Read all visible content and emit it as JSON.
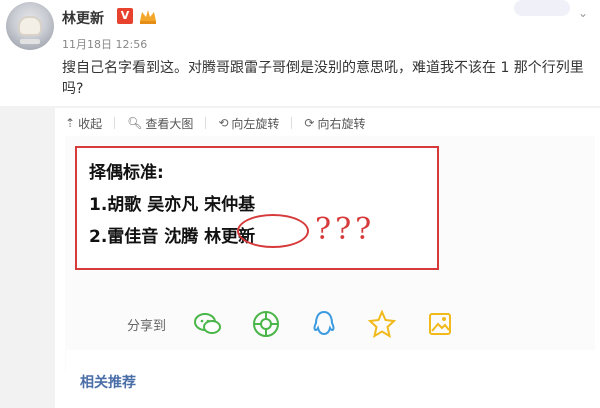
{
  "user": {
    "name": "林更新",
    "badge": "V",
    "time": "11月18日 12:56"
  },
  "post": {
    "text": "搜自己名字看到这。对腾哥跟雷子哥倒是没别的意思吼，难道我不该在 1 那个行列里吗?"
  },
  "toolbar": {
    "collapse": "收起",
    "view_large": "查看大图",
    "rotate_left": "向左旋转",
    "rotate_right": "向右旋转"
  },
  "image": {
    "line1": "择偶标准:",
    "line2": "1.胡歌 吴亦凡 宋仲基",
    "line3": "2.雷佳音 沈腾 林更新"
  },
  "share": {
    "label": "分享到",
    "icons": [
      "wechat-icon",
      "moments-icon",
      "qq-icon",
      "qzone-icon",
      "album-icon"
    ]
  },
  "related": {
    "title": "相关推荐"
  },
  "colors": {
    "accent_red": "#d63a3a",
    "link_blue": "#4a6ea8",
    "green": "#4ab548",
    "blue": "#3d9be0",
    "yellow": "#f2b91a"
  }
}
